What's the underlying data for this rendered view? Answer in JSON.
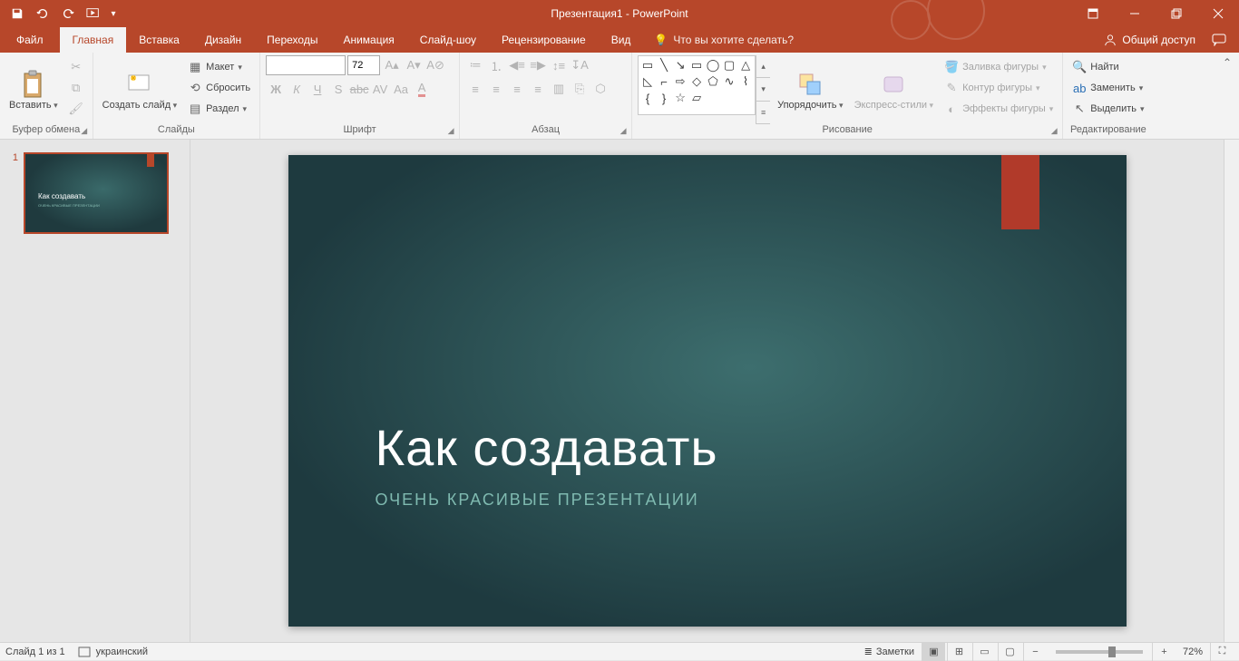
{
  "title": "Презентация1 - PowerPoint",
  "qat": {
    "save": "save",
    "undo": "undo",
    "redo": "redo",
    "start": "start-from-beginning"
  },
  "tabs": {
    "file": "Файл",
    "home": "Главная",
    "insert": "Вставка",
    "design": "Дизайн",
    "transitions": "Переходы",
    "animations": "Анимация",
    "slideshow": "Слайд-шоу",
    "review": "Рецензирование",
    "view": "Вид"
  },
  "tellme": "Что вы хотите сделать?",
  "share": "Общий доступ",
  "groups": {
    "clipboard": {
      "label": "Буфер обмена",
      "paste": "Вставить",
      "cut": "Вырезать",
      "copy": "Копировать",
      "format_painter": "Формат по образцу"
    },
    "slides": {
      "label": "Слайды",
      "new_slide": "Создать слайд",
      "layout": "Макет",
      "reset": "Сбросить",
      "section": "Раздел"
    },
    "font": {
      "label": "Шрифт",
      "size": "72"
    },
    "paragraph": {
      "label": "Абзац"
    },
    "drawing": {
      "label": "Рисование",
      "arrange": "Упорядочить",
      "quick_styles": "Экспресс-стили",
      "shape_fill": "Заливка фигуры",
      "shape_outline": "Контур фигуры",
      "shape_effects": "Эффекты фигуры"
    },
    "editing": {
      "label": "Редактирование",
      "find": "Найти",
      "replace": "Заменить",
      "select": "Выделить"
    }
  },
  "slide": {
    "title": "Как создавать",
    "subtitle": "ОЧЕНЬ КРАСИВЫЕ ПРЕЗЕНТАЦИИ"
  },
  "thumb": {
    "num": "1"
  },
  "status": {
    "slide_info": "Слайд 1 из 1",
    "language": "украинский",
    "notes": "Заметки",
    "zoom": "72%"
  }
}
